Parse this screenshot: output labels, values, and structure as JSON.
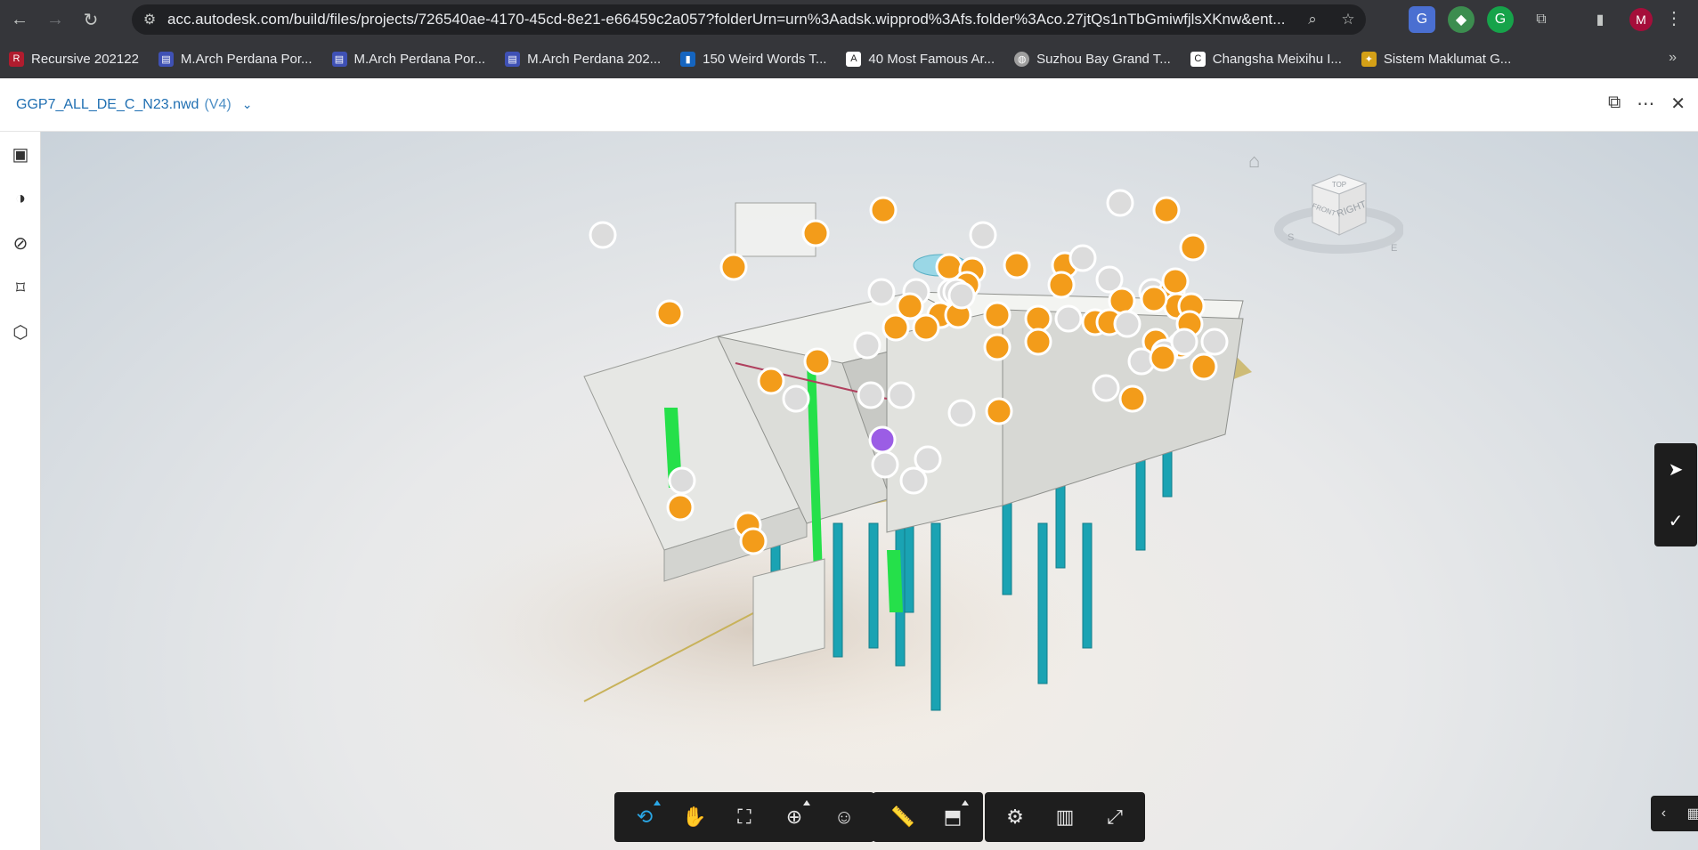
{
  "browser": {
    "url": "acc.autodesk.com/build/files/projects/726540ae-4170-45cd-8e21-e66459c2a057?folderUrn=urn%3Aadsk.wipprod%3Afs.folder%3Aco.27jtQs1nTbGmiwfjlsXKnw&ent...",
    "avatar_letter": "M"
  },
  "bookmarks": [
    {
      "label": "Recursive 202122",
      "color": "#b01c2e"
    },
    {
      "label": "M.Arch Perdana Por...",
      "color": "#3f51b5"
    },
    {
      "label": "M.Arch Perdana Por...",
      "color": "#3f51b5"
    },
    {
      "label": "M.Arch Perdana 202...",
      "color": "#3f51b5"
    },
    {
      "label": "150 Weird Words T...",
      "color": "#1565c0"
    },
    {
      "label": "40 Most Famous Ar...",
      "color": "#ffffff"
    },
    {
      "label": "Suzhou Bay Grand T...",
      "color": "#9e9e9e"
    },
    {
      "label": "Changsha Meixihu I...",
      "color": "#ffffff"
    },
    {
      "label": "Sistem Maklumat G...",
      "color": "#d4a017"
    }
  ],
  "app": {
    "file_name": "GGP7_ALL_DE_C_N23.nwd",
    "version": "(V4)"
  },
  "viewcube": {
    "top": "TOP",
    "front": "FRONT",
    "right": "RIGHT",
    "s": "S",
    "e": "E"
  },
  "toolbar": {
    "nav_tools": [
      "orbit",
      "pan",
      "fit-to-view",
      "zoom-window",
      "first-person"
    ],
    "measure_tools": [
      "measure",
      "section"
    ],
    "settings_tools": [
      "settings",
      "model-browser",
      "fullscreen"
    ]
  },
  "colors": {
    "issue_open": "#f39c1a",
    "issue_closed": "#dcdcdc",
    "issue_selected": "#9b5de5",
    "steel": "#1aa3b3",
    "highlight": "#25e04a"
  }
}
